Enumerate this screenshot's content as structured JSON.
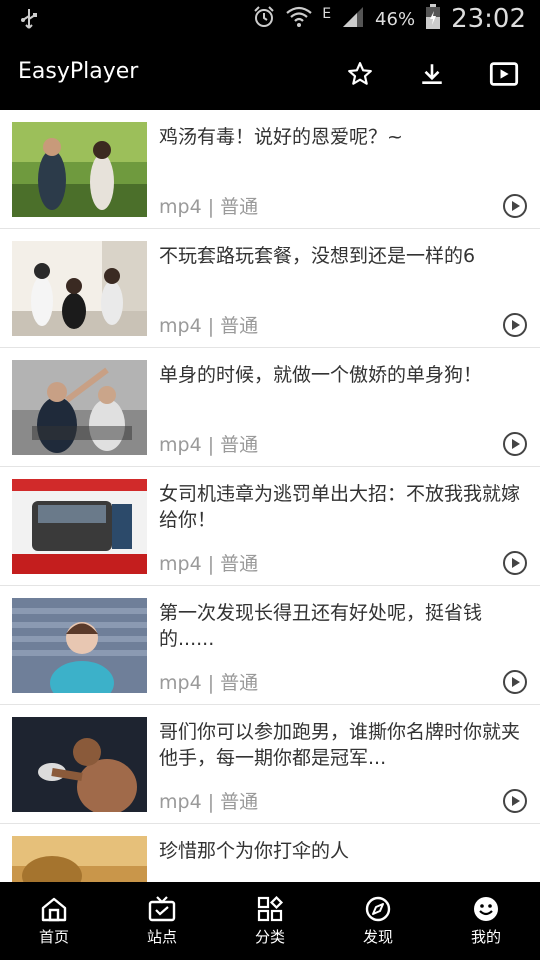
{
  "status_bar": {
    "battery": "46%",
    "network_type": "E",
    "time": "23:02",
    "icons": [
      "usb-icon",
      "alarm-icon",
      "wifi-icon",
      "signal-icon",
      "battery-icon"
    ]
  },
  "app_bar": {
    "title": "EasyPlayer",
    "actions": [
      "star-icon",
      "download-icon",
      "play-box-icon"
    ]
  },
  "videos": [
    {
      "title": "鸡汤有毒！说好的恩爱呢？~",
      "meta": "mp4 | 普通"
    },
    {
      "title": "不玩套路玩套餐，没想到还是一样的6",
      "meta": "mp4 | 普通"
    },
    {
      "title": "单身的时候，就做一个傲娇的单身狗！",
      "meta": "mp4 | 普通"
    },
    {
      "title": "女司机违章为逃罚单出大招：不放我我就嫁给你！",
      "meta": "mp4 | 普通"
    },
    {
      "title": "第一次发现长得丑还有好处呢，挺省钱的......",
      "meta": "mp4 | 普通"
    },
    {
      "title": "哥们你可以参加跑男，谁撕你名牌时你就夹他手，每一期你都是冠军...",
      "meta": "mp4 | 普通"
    },
    {
      "title": "珍惜那个为你打伞的人",
      "meta": ""
    }
  ],
  "bottom_nav": [
    {
      "label": "首页",
      "icon": "home-icon"
    },
    {
      "label": "站点",
      "icon": "tv-icon"
    },
    {
      "label": "分类",
      "icon": "grid-icon"
    },
    {
      "label": "发现",
      "icon": "compass-icon"
    },
    {
      "label": "我的",
      "icon": "smile-icon"
    }
  ]
}
